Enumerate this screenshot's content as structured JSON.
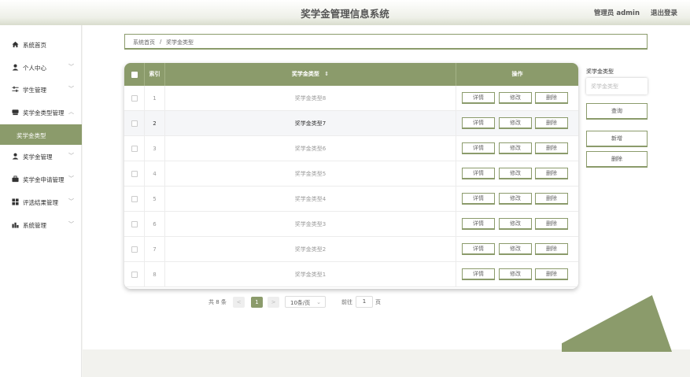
{
  "header": {
    "title": "奖学金管理信息系统",
    "user": "管理员 admin",
    "logout": "退出登录"
  },
  "sidebar": {
    "items": [
      {
        "label": "系统首页",
        "icon": "home-icon"
      },
      {
        "label": "个人中心",
        "icon": "user-icon"
      },
      {
        "label": "学生管理",
        "icon": "sliders-icon"
      },
      {
        "label": "奖学金类型管理",
        "icon": "box-icon"
      },
      {
        "label": "奖学金管理",
        "icon": "user-icon"
      },
      {
        "label": "奖学金申请管理",
        "icon": "briefcase-icon"
      },
      {
        "label": "评选结果管理",
        "icon": "grid-icon"
      },
      {
        "label": "系统管理",
        "icon": "chart-icon"
      }
    ],
    "active_sub": "奖学金类型"
  },
  "breadcrumb": {
    "home": "系统首页",
    "sep": "/",
    "current": "奖学金类型"
  },
  "table": {
    "headers": {
      "index": "索引",
      "type": "奖学金类型",
      "sort_icon": "⇕",
      "actions": "操作"
    },
    "actions": {
      "detail": "详情",
      "edit": "修改",
      "delete": "删除"
    },
    "rows": [
      {
        "index": "1",
        "type": "奖学金类型8"
      },
      {
        "index": "2",
        "type": "奖学金类型7"
      },
      {
        "index": "3",
        "type": "奖学金类型6"
      },
      {
        "index": "4",
        "type": "奖学金类型5"
      },
      {
        "index": "5",
        "type": "奖学金类型4"
      },
      {
        "index": "6",
        "type": "奖学金类型3"
      },
      {
        "index": "7",
        "type": "奖学金类型2"
      },
      {
        "index": "8",
        "type": "奖学金类型1"
      }
    ]
  },
  "search": {
    "label": "奖学金类型",
    "placeholder": "奖学金类型",
    "query": "查询",
    "add": "新增",
    "delete": "删除"
  },
  "pagination": {
    "total": "共 8 条",
    "prev": "<",
    "page": "1",
    "next": ">",
    "page_size": "10条/页",
    "goto": "前往",
    "goto_value": "1",
    "page_suffix": "页"
  },
  "colors": {
    "accent": "#8b9b6b"
  }
}
